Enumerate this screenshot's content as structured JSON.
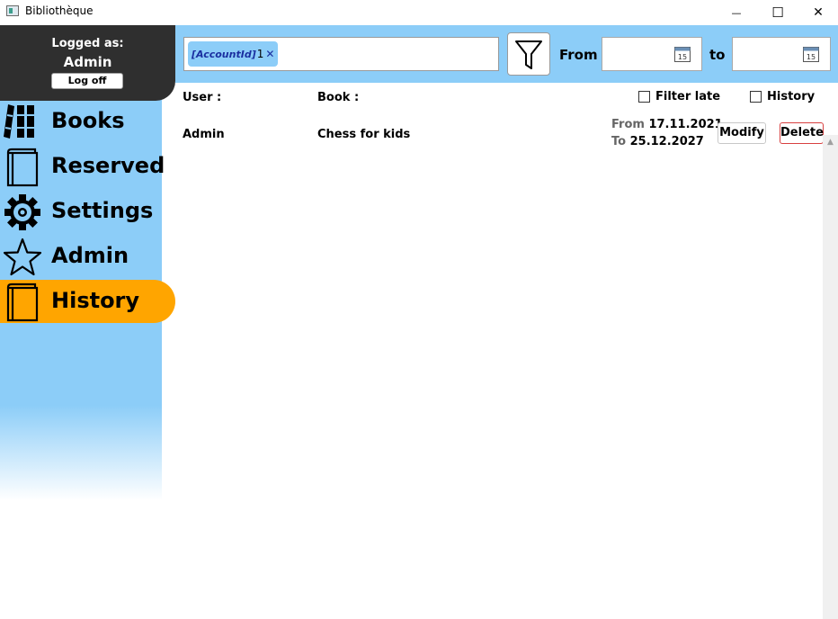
{
  "window": {
    "title": "Bibliothèque",
    "controls": {
      "minimize": "—",
      "maximize": "☐",
      "close": "✕"
    }
  },
  "login": {
    "logged_as": "Logged as:",
    "user": "Admin",
    "logoff_label": "Log off"
  },
  "nav": {
    "items": [
      {
        "label": "Books",
        "icon": "books-icon"
      },
      {
        "label": "Reserved",
        "icon": "book-icon"
      },
      {
        "label": "Settings",
        "icon": "gear-icon"
      },
      {
        "label": "Admin",
        "icon": "star-icon"
      },
      {
        "label": "History",
        "icon": "book-icon"
      }
    ],
    "active": "History"
  },
  "filter": {
    "tag_name": "[AccountId]",
    "tag_value": "1",
    "tag_remove": "✕",
    "from_label": "From",
    "to_label": "to",
    "from_date": "",
    "to_date": "",
    "calendar_day": "15"
  },
  "list_header": {
    "user": "User :",
    "book": "Book :",
    "filter_late": "Filter late",
    "history": "History",
    "filter_late_checked": false,
    "history_checked": false
  },
  "rows": [
    {
      "user": "Admin",
      "book": "Chess for kids",
      "from_label": "From",
      "from_date": "17.11.2021",
      "to_label": "To",
      "to_date": "25.12.2027",
      "modify_label": "Modify",
      "delete_label": "Delete"
    }
  ],
  "colors": {
    "sidebar": "#8ccdf8",
    "active_nav": "#ffa500",
    "login_panel": "#2f2f2f",
    "delete_border": "#d84040"
  }
}
